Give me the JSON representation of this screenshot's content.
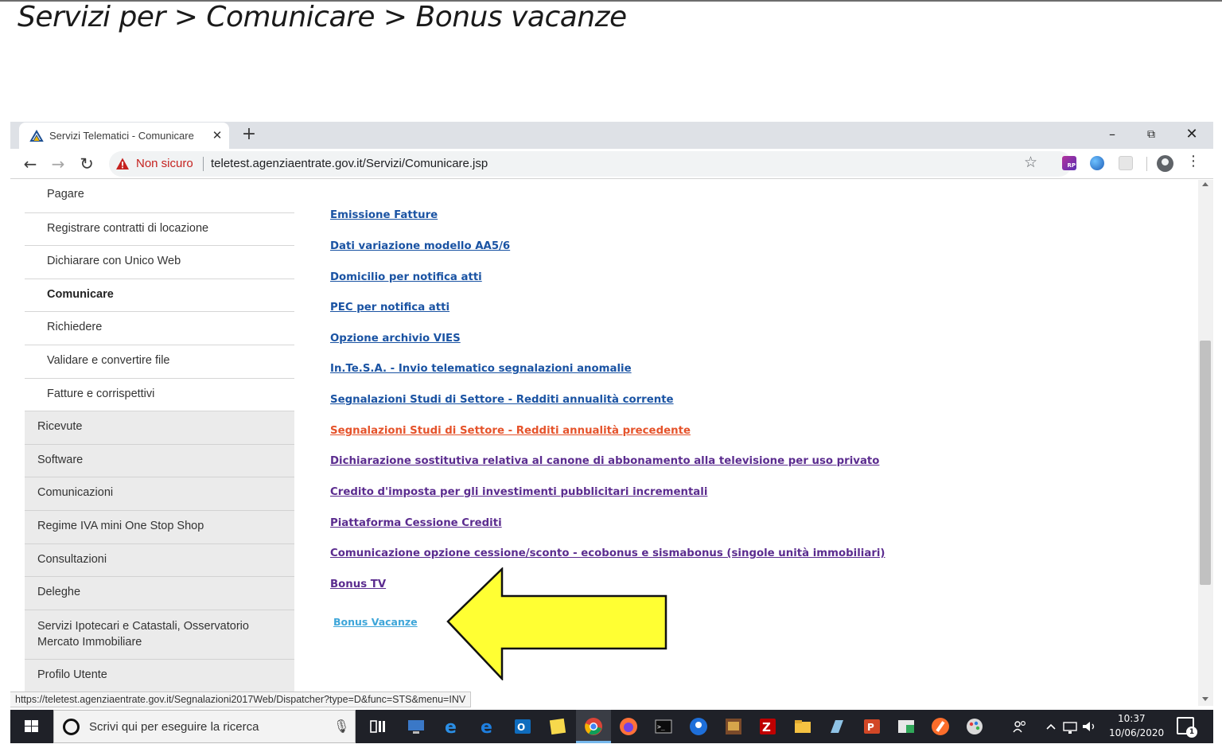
{
  "slide": {
    "title": "Servizi per > Comunicare > Bonus vacanze"
  },
  "browser": {
    "tab_title": "Servizi Telematici - Comunicare",
    "tab_close": "✕",
    "new_tab": "+",
    "window_controls": {
      "minimize": "–",
      "maximize": "⧉",
      "close": "✕"
    },
    "nav": {
      "back": "←",
      "forward": "→",
      "reload": "↻"
    },
    "security_label": "Non sicuro",
    "url": "teletest.agenziaentrate.gov.it/Servizi/Comunicare.jsp",
    "bookmark_star": "☆",
    "extension_rp": "RP",
    "menu": "⋮"
  },
  "sidebar": {
    "sub_items": [
      "Pagare",
      "Registrare contratti di locazione",
      "Dichiarare con Unico Web",
      "Comunicare",
      "Richiedere",
      "Validare e convertire file",
      "Fatture e corrispettivi"
    ],
    "active_item": "Comunicare",
    "main_items": [
      "Ricevute",
      "Software",
      "Comunicazioni",
      "Regime IVA mini One Stop Shop",
      "Consultazioni",
      "Deleghe",
      "Servizi Ipotecari e Catastali, Osservatorio Mercato Immobiliare",
      "Profilo Utente"
    ]
  },
  "content": {
    "links": [
      "Emissione Fatture",
      "Dati variazione modello AA5/6",
      "Domicilio per notifica atti",
      "PEC per notifica atti",
      "Opzione archivio VIES",
      "In.Te.S.A. - Invio telematico segnalazioni anomalie",
      "Segnalazioni Studi di Settore - Redditi annualità corrente",
      "Segnalazioni Studi di Settore - Redditi annualità precedente",
      "Dichiarazione sostitutiva relativa al canone di abbonamento alla televisione per uso privato",
      "Credito d'imposta per gli investimenti pubblicitari incrementali",
      "Piattaforma Cessione Crediti",
      "Comunicazione opzione cessione/sconto - ecobonus e sismabonus (singole unità immobiliari)",
      "Bonus TV",
      "Bonus Vacanze"
    ],
    "arrow_color": "#ffff33"
  },
  "status_bar": {
    "url": "https://teletest.agenziaentrate.gov.it/Segnalazioni2017Web/Dispatcher?type=D&func=STS&menu=INV"
  },
  "taskbar": {
    "search_placeholder": "Scrivi qui per eseguire la ricerca",
    "mic": "🎙",
    "clock_time": "10:37",
    "clock_date": "10/06/2020",
    "notification_count": "1",
    "tray_icons": [
      "people-icon",
      "chevron-up-icon",
      "network-icon",
      "volume-icon"
    ],
    "pinned_icons": [
      "task-view-icon",
      "remote-desktop-icon",
      "internet-explorer-icon",
      "edge-icon",
      "outlook-icon",
      "sticky-notes-icon",
      "chrome-icon",
      "firefox-icon",
      "terminal-icon",
      "maps-icon",
      "game-icon",
      "filezilla-icon",
      "file-explorer-icon",
      "tool-icon",
      "powerpoint-icon",
      "project-icon",
      "brave-icon",
      "paint-icon"
    ]
  }
}
